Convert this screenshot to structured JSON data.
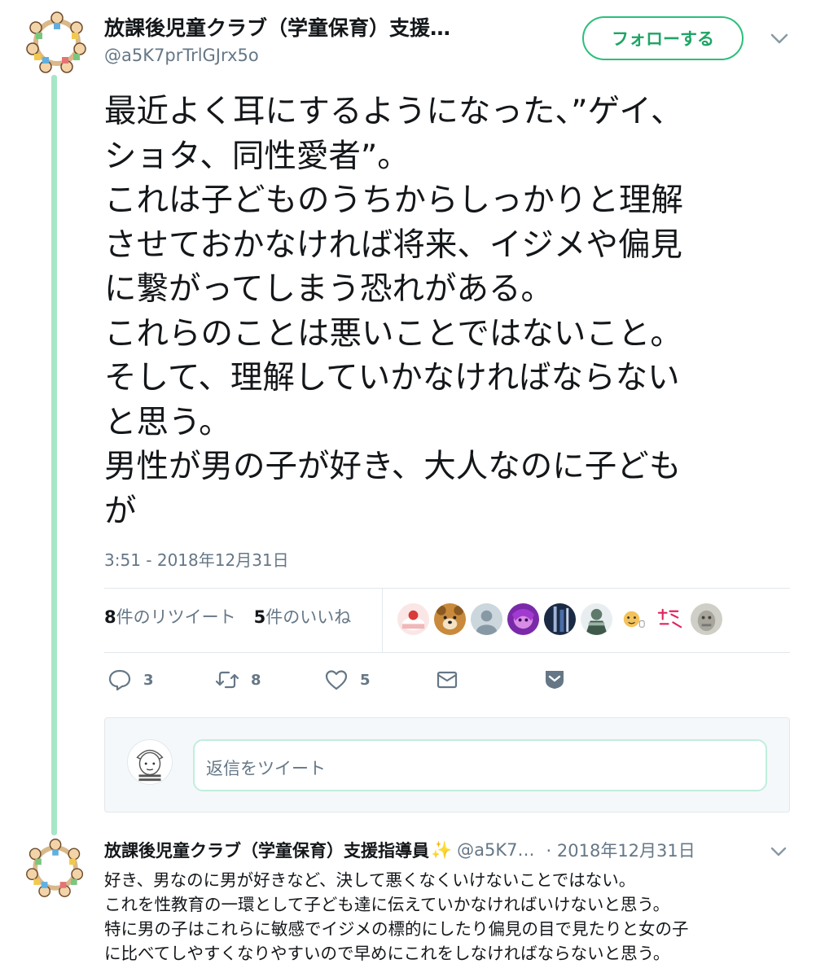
{
  "main_tweet": {
    "display_name": "放課後児童クラブ（学童保育）支援…",
    "handle": "@a5K7prTrlGJrx5o",
    "follow_label": "フォローする",
    "text_lines": [
      "最近よく耳にするようになった、”ゲイ、",
      "ショタ、同性愛者”。",
      "これは子どものうちからしっかりと理解",
      "させておかなければ将来、イジメや偏見",
      "に繋がってしまう恐れがある。",
      "これらのことは悪いことではないこと。",
      "そして、理解していかなければならない",
      "と思う。",
      "男性が男の子が好き、大人なのに子ども",
      "が"
    ],
    "timestamp": "3:51 - 2018年12月31日",
    "retweets_count": "8",
    "retweets_label": "件のリツイート",
    "likes_count": "5",
    "likes_label": "件のいいね",
    "actions": {
      "reply_count": "3",
      "retweet_count": "8",
      "like_count": "5"
    }
  },
  "reply_box": {
    "placeholder": "返信をツイート"
  },
  "reply_tweet": {
    "display_name": "放課後児童クラブ（学童保育）支援指導員",
    "sparkle": "✨",
    "handle": "@a5K7…",
    "date": "· 2018年12月31日",
    "text_lines": [
      "好き、男なのに男が好きなど、決して悪くなくいけないことではない。",
      "これを性教育の一環として子ども達に伝えていかなければいけないと思う。",
      "特に男の子はこれらに敏感でイジメの標的にしたり偏見の目で見たりと女の子",
      "に比べてしやすくなりやすいので早めにこれをしなければならないと思う。"
    ]
  },
  "colors": {
    "accent_green": "#2bbf7b",
    "thread_line": "#a8e6c8",
    "muted_text": "#657786"
  },
  "icons": [
    "chevron-down-icon",
    "reply-icon",
    "retweet-icon",
    "heart-icon",
    "envelope-icon",
    "bookmark-icon"
  ]
}
